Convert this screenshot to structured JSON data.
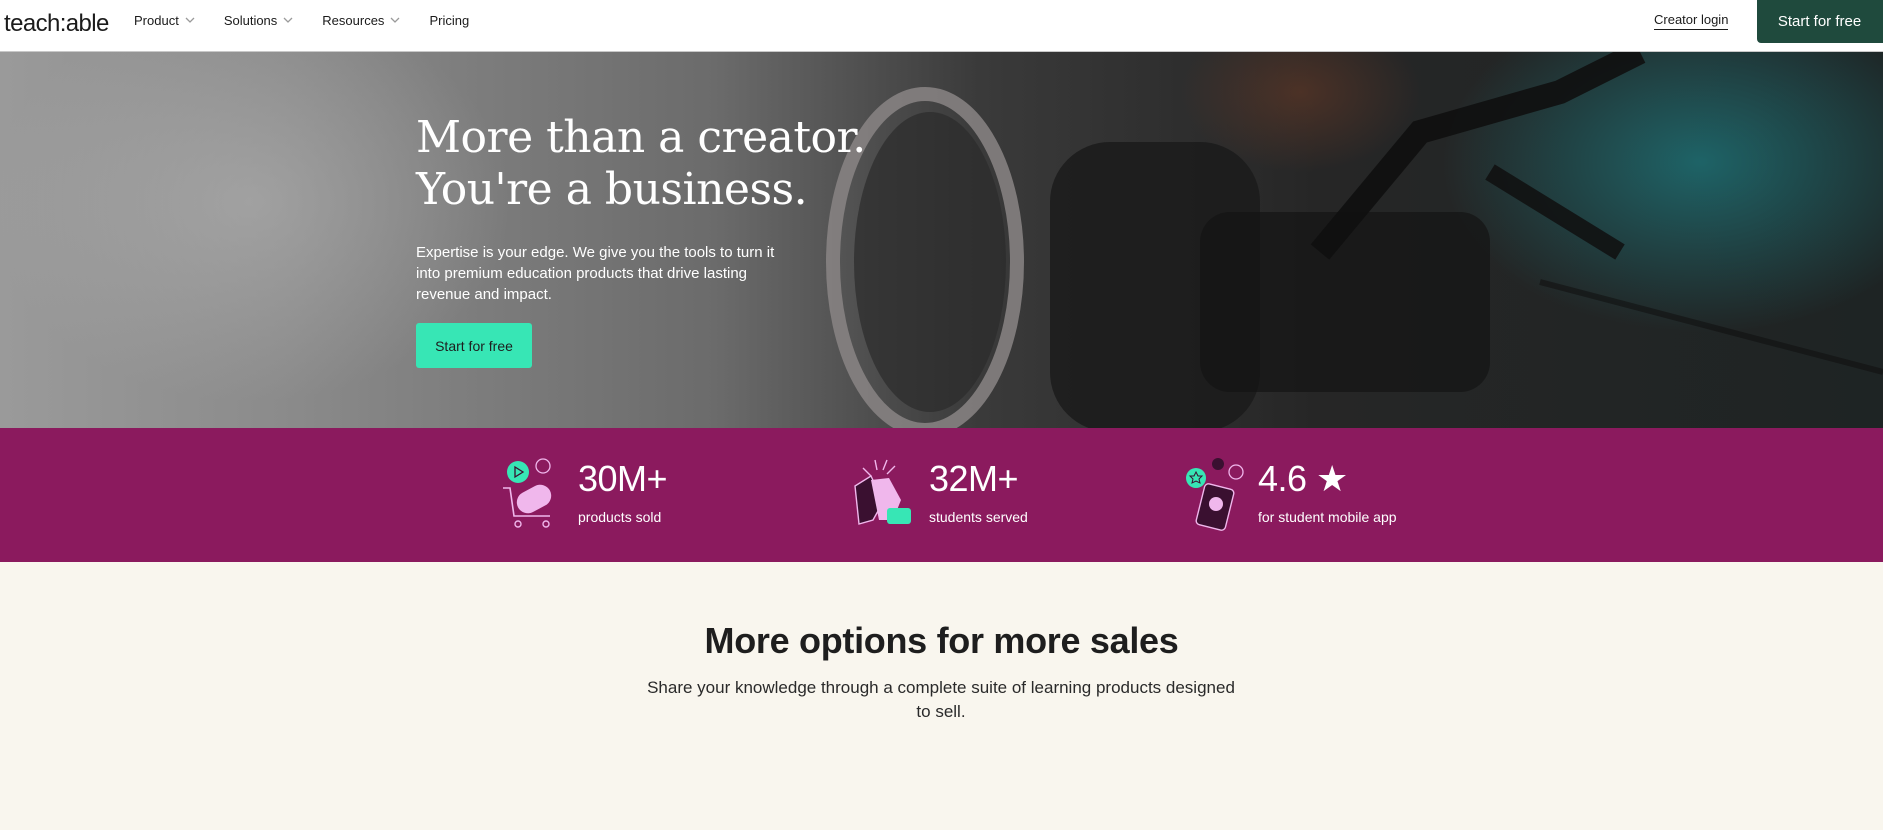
{
  "header": {
    "logo": "teach:able",
    "nav": [
      {
        "label": "Product",
        "has_dropdown": true
      },
      {
        "label": "Solutions",
        "has_dropdown": true
      },
      {
        "label": "Resources",
        "has_dropdown": true
      },
      {
        "label": "Pricing",
        "has_dropdown": false
      }
    ],
    "login_label": "Creator login",
    "cta_label": "Start for free"
  },
  "hero": {
    "title_line1": "More than a creator.",
    "title_line2": "You're a business.",
    "subtitle": "Expertise is your edge. We give you the tools to turn it into premium education products that drive lasting revenue and impact.",
    "cta_label": "Start for free"
  },
  "stats": [
    {
      "value": "30M+",
      "label": "products sold",
      "icon": "shopping-cart-icon"
    },
    {
      "value": "32M+",
      "label": "students served",
      "icon": "high-five-icon"
    },
    {
      "value": "4.6 ★",
      "label": "for student mobile app",
      "icon": "mobile-rating-icon"
    }
  ],
  "options": {
    "title": "More options for more sales",
    "subtitle": "Share your knowledge through a complete suite of learning products designed to sell."
  },
  "colors": {
    "brand_dark": "#1f4a3d",
    "accent_green": "#37e6b5",
    "stats_bg": "#8b1a5e",
    "page_bg": "#f9f6ee",
    "icon_pink": "#f0b7ec"
  }
}
